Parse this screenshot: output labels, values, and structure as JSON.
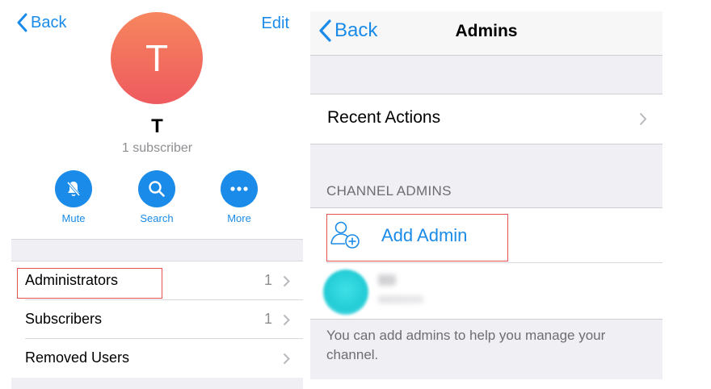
{
  "left": {
    "back_label": "Back",
    "edit_label": "Edit",
    "avatar_initial": "T",
    "channel_name": "T",
    "subscriber_text": "1 subscriber",
    "actions": {
      "mute": "Mute",
      "search": "Search",
      "more": "More"
    },
    "rows": {
      "administrators": {
        "label": "Administrators",
        "count": "1"
      },
      "subscribers": {
        "label": "Subscribers",
        "count": "1"
      },
      "removed": {
        "label": "Removed Users"
      }
    }
  },
  "right": {
    "back_label": "Back",
    "title": "Admins",
    "recent_actions": "Recent Actions",
    "section_header": "CHANNEL ADMINS",
    "add_admin": "Add Admin",
    "footer_note": "You can add admins to help you manage your channel."
  },
  "colors": {
    "accent": "#1a8be8",
    "avatar_top": "#f6865e",
    "avatar_bottom": "#ef5a5f",
    "highlight_box": "#e35151",
    "group_background": "#efeff4"
  }
}
